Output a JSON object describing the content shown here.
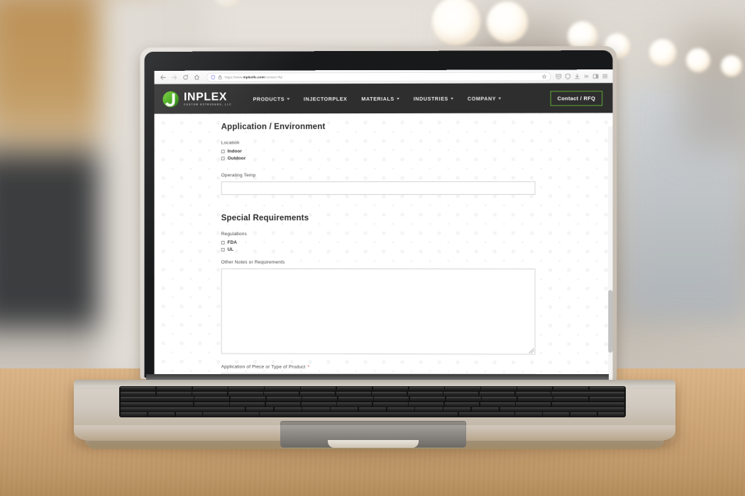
{
  "browser": {
    "nav": {
      "back_icon": "arrow-left-icon",
      "forward_icon": "arrow-right-icon",
      "reload_icon": "reload-icon",
      "home_icon": "home-icon"
    },
    "url": {
      "scheme": "https://www.",
      "domain": "inplexllc.com",
      "path": "/contact-rfq/",
      "shield_icon": "shield-icon",
      "lock_icon": "lock-icon",
      "bookmark_icon": "star-icon"
    },
    "toolbar_icons": [
      "pocket-icon",
      "shield-icon",
      "download-icon",
      "linkedin-icon",
      "sidebar-icon",
      "menu-icon"
    ]
  },
  "site": {
    "brand": {
      "name": "INPLEX",
      "tagline": "CUSTOM EXTRUDERS, LLC",
      "logo_icon": "inplex-j-logo",
      "accent_green": "#4caf1f",
      "header_bg": "#2e2e2e"
    },
    "nav_items": [
      {
        "label": "PRODUCTS",
        "has_caret": true
      },
      {
        "label": "INJECTORPLEX",
        "has_caret": false
      },
      {
        "label": "MATERIALS",
        "has_caret": true
      },
      {
        "label": "INDUSTRIES",
        "has_caret": true
      },
      {
        "label": "COMPANY",
        "has_caret": true
      }
    ],
    "cta": {
      "label": "Contact / RFQ",
      "border_color": "#5ea832"
    }
  },
  "form": {
    "sections": [
      {
        "title": "Application / Environment",
        "location_label": "Location",
        "location_options": [
          {
            "label": "Indoor",
            "checked": false
          },
          {
            "label": "Outdoor",
            "checked": false
          }
        ],
        "operating_temp_label": "Operating Temp",
        "operating_temp_value": ""
      },
      {
        "title": "Special Requirements",
        "regulations_label": "Regulations",
        "regulations_options": [
          {
            "label": "FDA",
            "checked": false
          },
          {
            "label": "UL",
            "checked": false
          }
        ],
        "notes_label": "Other Notes or Requirements",
        "notes_value": ""
      }
    ],
    "application_label": "Application of Piece or Type of Product",
    "application_required_marker": "*",
    "application_value": ""
  }
}
